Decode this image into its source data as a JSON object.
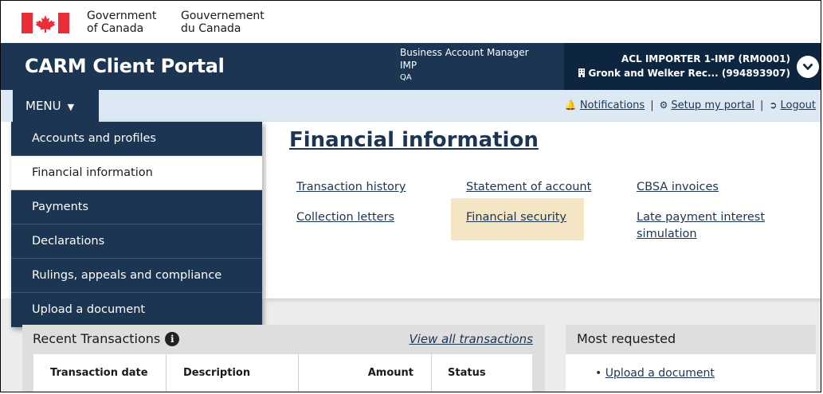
{
  "goc_banner": {
    "en_line1": "Government",
    "en_line2": "of Canada",
    "fr_line1": "Gouvernement",
    "fr_line2": "du Canada",
    "flag_color": "#eb2d37"
  },
  "header": {
    "portal_title": "CARM Client Portal",
    "role_line1": "Business Account Manager",
    "role_line2": "IMP",
    "role_line3": "QA",
    "account_line1": "ACL IMPORTER 1-IMP (RM0001)",
    "account_line2": "Gronk and Welker Rec...  (994893907)",
    "account_icon": "building-icon",
    "toggle_icon": "chevron-down-icon",
    "background_color": "#1b3553"
  },
  "menubar": {
    "menu_label": "MENU",
    "notifications": "Notifications",
    "setup": "Setup my portal",
    "logout": "Logout",
    "notifications_icon": "bell-icon",
    "setup_icon": "gear-icon",
    "logout_icon": "sign-out-icon"
  },
  "menu_items": [
    {
      "label": "Accounts and profiles"
    },
    {
      "label": "Financial information"
    },
    {
      "label": "Payments"
    },
    {
      "label": "Declarations"
    },
    {
      "label": "Rulings, appeals and compliance"
    },
    {
      "label": "Upload a document"
    }
  ],
  "main": {
    "title": "Financial information",
    "links": {
      "transaction_history": "Transaction history",
      "statement_of_account": "Statement of account",
      "cbsa_invoices": "CBSA invoices",
      "collection_letters": "Collection letters",
      "financial_security": "Financial security",
      "late_payment_line1": "Late payment interest",
      "late_payment_line2": "simulation"
    },
    "highlight_color": "#f4e5c4"
  },
  "recent": {
    "title": "Recent Transactions",
    "info_icon": "info-icon",
    "view_all": "View all transactions",
    "columns": [
      "Transaction date",
      "Description",
      "Amount",
      "Status"
    ]
  },
  "most_requested": {
    "title": "Most requested",
    "link": "Upload a document"
  }
}
